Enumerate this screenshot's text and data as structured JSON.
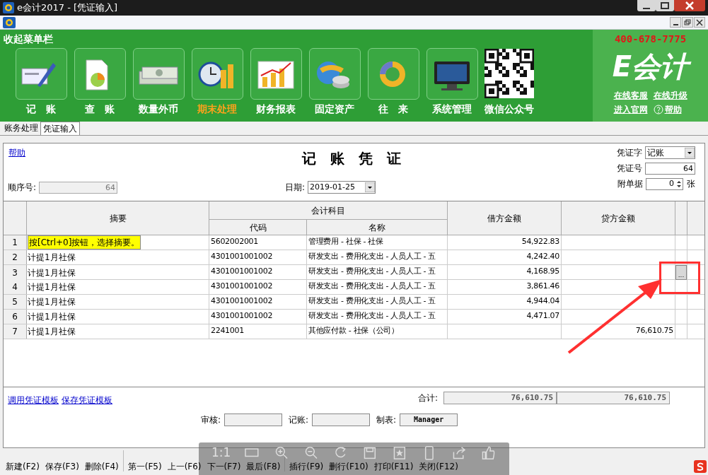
{
  "window": {
    "title": "e会计2017 - [凭证输入]"
  },
  "banner": {
    "collapse": "收起菜单栏",
    "phone": "400-678-7775",
    "logo": "E会计",
    "links": [
      "在线客服",
      "在线升级",
      "进入官网",
      "帮助"
    ],
    "qr_label": "微信公众号"
  },
  "menu": [
    {
      "label": "记　账",
      "selected": false
    },
    {
      "label": "查　账",
      "selected": false
    },
    {
      "label": "数量外币",
      "selected": false
    },
    {
      "label": "期末处理",
      "selected": true
    },
    {
      "label": "财务报表",
      "selected": false
    },
    {
      "label": "固定资产",
      "selected": false
    },
    {
      "label": "往　来",
      "selected": false
    },
    {
      "label": "系统管理",
      "selected": false
    }
  ],
  "tabs": [
    {
      "label": "账务处理",
      "selected": false
    },
    {
      "label": "凭证输入",
      "selected": true
    }
  ],
  "voucher": {
    "help": "帮助",
    "title": "记　账　凭　证",
    "type_label": "凭证字",
    "type_value": "记账",
    "number_label": "凭证号",
    "number_value": "64",
    "attach_label": "附单据",
    "attach_value": "0",
    "attach_unit": "张",
    "seq_label": "顺序号:",
    "seq_value": "64",
    "date_label": "日期:",
    "date_value": "2019-01-25"
  },
  "table": {
    "columns": {
      "summary": "摘要",
      "account": "会计科目",
      "code": "代码",
      "name": "名称",
      "debit": "借方金额",
      "credit": "贷方金额"
    },
    "rows": [
      {
        "no": "1",
        "summary": "按[Ctrl+0]按钮，选择摘要。",
        "hint": true,
        "code": "5602002001",
        "name": "管理费用 - 社保 - 社保",
        "debit": "54,922.83",
        "credit": ""
      },
      {
        "no": "2",
        "summary": "计提1月社保",
        "hint": false,
        "code": "4301001001002",
        "name": "研发支出 - 费用化支出 - 人员人工 - 五",
        "debit": "4,242.40",
        "credit": ""
      },
      {
        "no": "3",
        "summary": "计提1月社保",
        "hint": false,
        "code": "4301001001002",
        "name": "研发支出 - 费用化支出 - 人员人工 - 五",
        "debit": "4,168.95",
        "credit": ""
      },
      {
        "no": "4",
        "summary": "计提1月社保",
        "hint": false,
        "code": "4301001001002",
        "name": "研发支出 - 费用化支出 - 人员人工 - 五",
        "debit": "3,861.46",
        "credit": ""
      },
      {
        "no": "5",
        "summary": "计提1月社保",
        "hint": false,
        "code": "4301001001002",
        "name": "研发支出 - 费用化支出 - 人员人工 - 五",
        "debit": "4,944.04",
        "credit": ""
      },
      {
        "no": "6",
        "summary": "计提1月社保",
        "hint": false,
        "code": "4301001001002",
        "name": "研发支出 - 费用化支出 - 人员人工 - 五",
        "debit": "4,471.07",
        "credit": ""
      },
      {
        "no": "7",
        "summary": "计提1月社保",
        "hint": false,
        "code": "2241001",
        "name": "其他应付款 - 社保（公司）",
        "debit": "",
        "credit": "76,610.75"
      }
    ],
    "ellipsis": "...",
    "total_label": "合计:",
    "total_debit": "76,610.75",
    "total_credit": "76,610.75"
  },
  "template_links": [
    "调用凭证模板",
    "保存凭证模板"
  ],
  "signoff": [
    {
      "label": "审核:"
    },
    {
      "label": "记账:"
    },
    {
      "label": "制表:",
      "value": "Manager"
    }
  ],
  "toolbar": [
    [
      "新建(F2)",
      "保存(F3)",
      "删除(F4)"
    ],
    [
      "第一(F5)",
      "上一(F6)",
      "下一(F7)",
      "最后(F8)"
    ],
    [
      "插行(F9)",
      "删行(F10)",
      "打印(F11)",
      "关闭(F12)"
    ]
  ],
  "viewer_overlay": {
    "zoom_label": "1:1"
  }
}
